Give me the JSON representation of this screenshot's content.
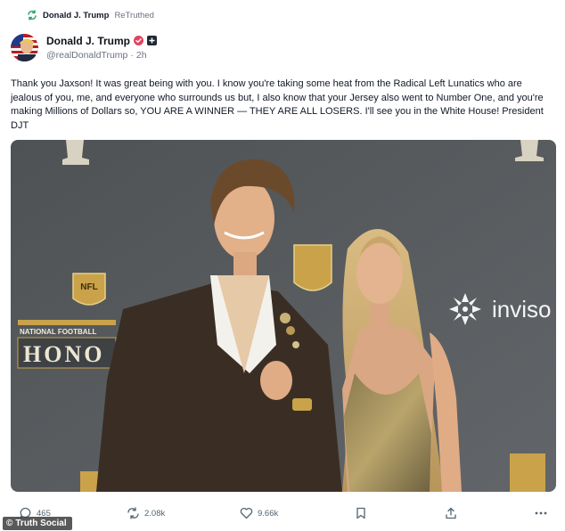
{
  "retruth": {
    "name": "Donald J. Trump",
    "label": "ReTruthed"
  },
  "author": {
    "display_name": "Donald J. Trump",
    "handle": "@realDonaldTrump",
    "time_ago": "2h"
  },
  "post": {
    "text": "Thank you Jaxson! It was great being with you. I know you're taking some heat from the Radical Left Lunatics who are jealous of you, me, and everyone who surrounds us but, I also know that your Jersey also went to Number One, and you're making Millions of Dollars so, YOU ARE A WINNER — THEY ARE ALL LOSERS. I'll see you in the White House! President DJT"
  },
  "image": {
    "backdrop_text": [
      "NATIONAL FOOTBALL",
      "HONO",
      "inviso"
    ],
    "backdrop_color": "#5a5d60"
  },
  "actions": {
    "replies": "465",
    "retruths": "2.08k",
    "likes": "9.66k"
  },
  "watermark": "Truth Social",
  "colors": {
    "accent": "#e3445f",
    "meta": "#6b7280",
    "retruth_green": "#22a06b"
  }
}
